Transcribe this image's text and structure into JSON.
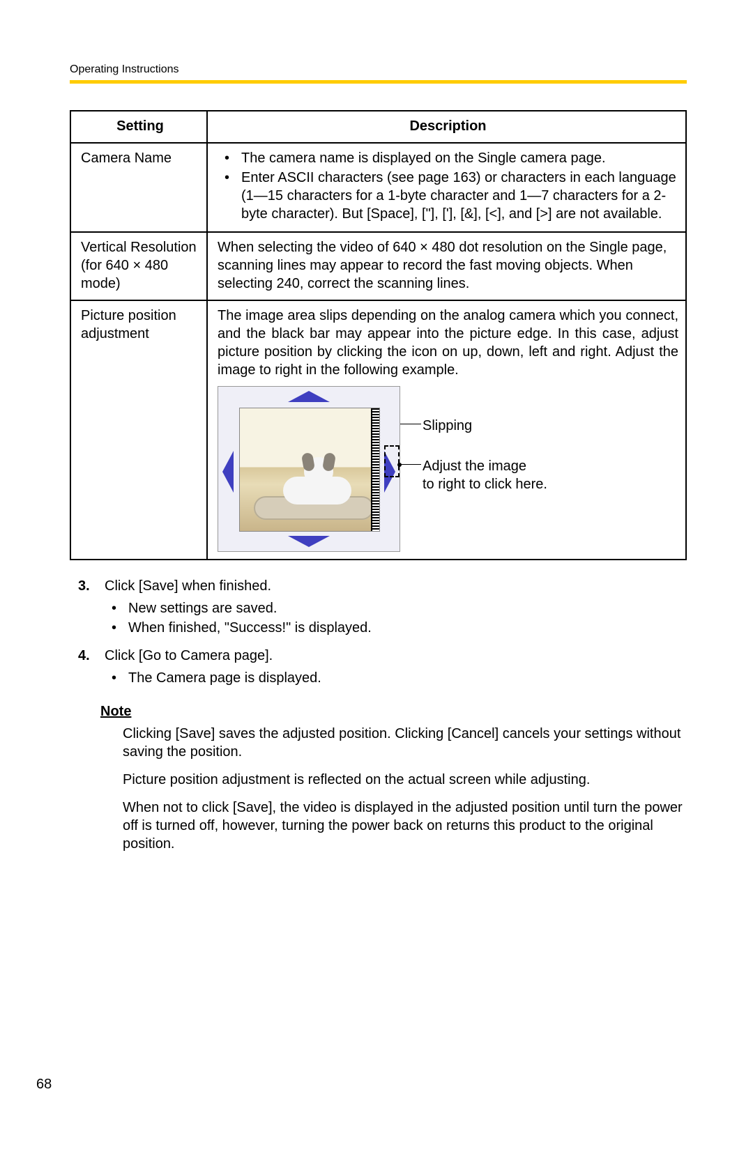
{
  "header": "Operating Instructions",
  "page_number": "68",
  "table": {
    "headers": {
      "setting": "Setting",
      "description": "Description"
    },
    "rows": [
      {
        "setting": "Camera Name",
        "bullets": [
          "The camera name is displayed on the Single camera page.",
          "Enter ASCII characters (see page 163) or characters in each language (1—15 characters for a 1-byte character and 1—7 characters for a 2-byte character). But [Space], [\"], ['], [&], [<], and [>] are not available."
        ]
      },
      {
        "setting": "Vertical Resolution (for 640 × 480 mode)",
        "text": "When selecting the video of 640 × 480 dot resolution on the Single page, scanning lines may appear to record the fast moving objects. When selecting 240, correct the scanning lines."
      },
      {
        "setting": "Picture position adjustment",
        "text": "The image area slips depending on the analog camera which you connect, and the black bar may appear into the picture edge. In this case, adjust picture position by clicking the icon on up, down, left and right. Adjust the image to right in the following example.",
        "callouts": {
          "slipping": "Slipping",
          "adjust_line1": "Adjust the image",
          "adjust_line2": "to right to click here."
        }
      }
    ]
  },
  "steps": [
    {
      "text": "Click [Save] when finished.",
      "bullets": [
        "New settings are saved.",
        "When finished, \"Success!\" is displayed."
      ]
    },
    {
      "text": "Click [Go to Camera page].",
      "bullets": [
        "The Camera page is displayed."
      ]
    }
  ],
  "note": {
    "heading": "Note",
    "paras": [
      "Clicking [Save] saves the adjusted position. Clicking [Cancel] cancels your settings without saving the position.",
      "Picture position adjustment is reflected on the actual screen while adjusting.",
      "When not to click [Save], the video is displayed in the adjusted position until turn the power off is turned off, however, turning the power back on returns this product to the original position."
    ]
  }
}
